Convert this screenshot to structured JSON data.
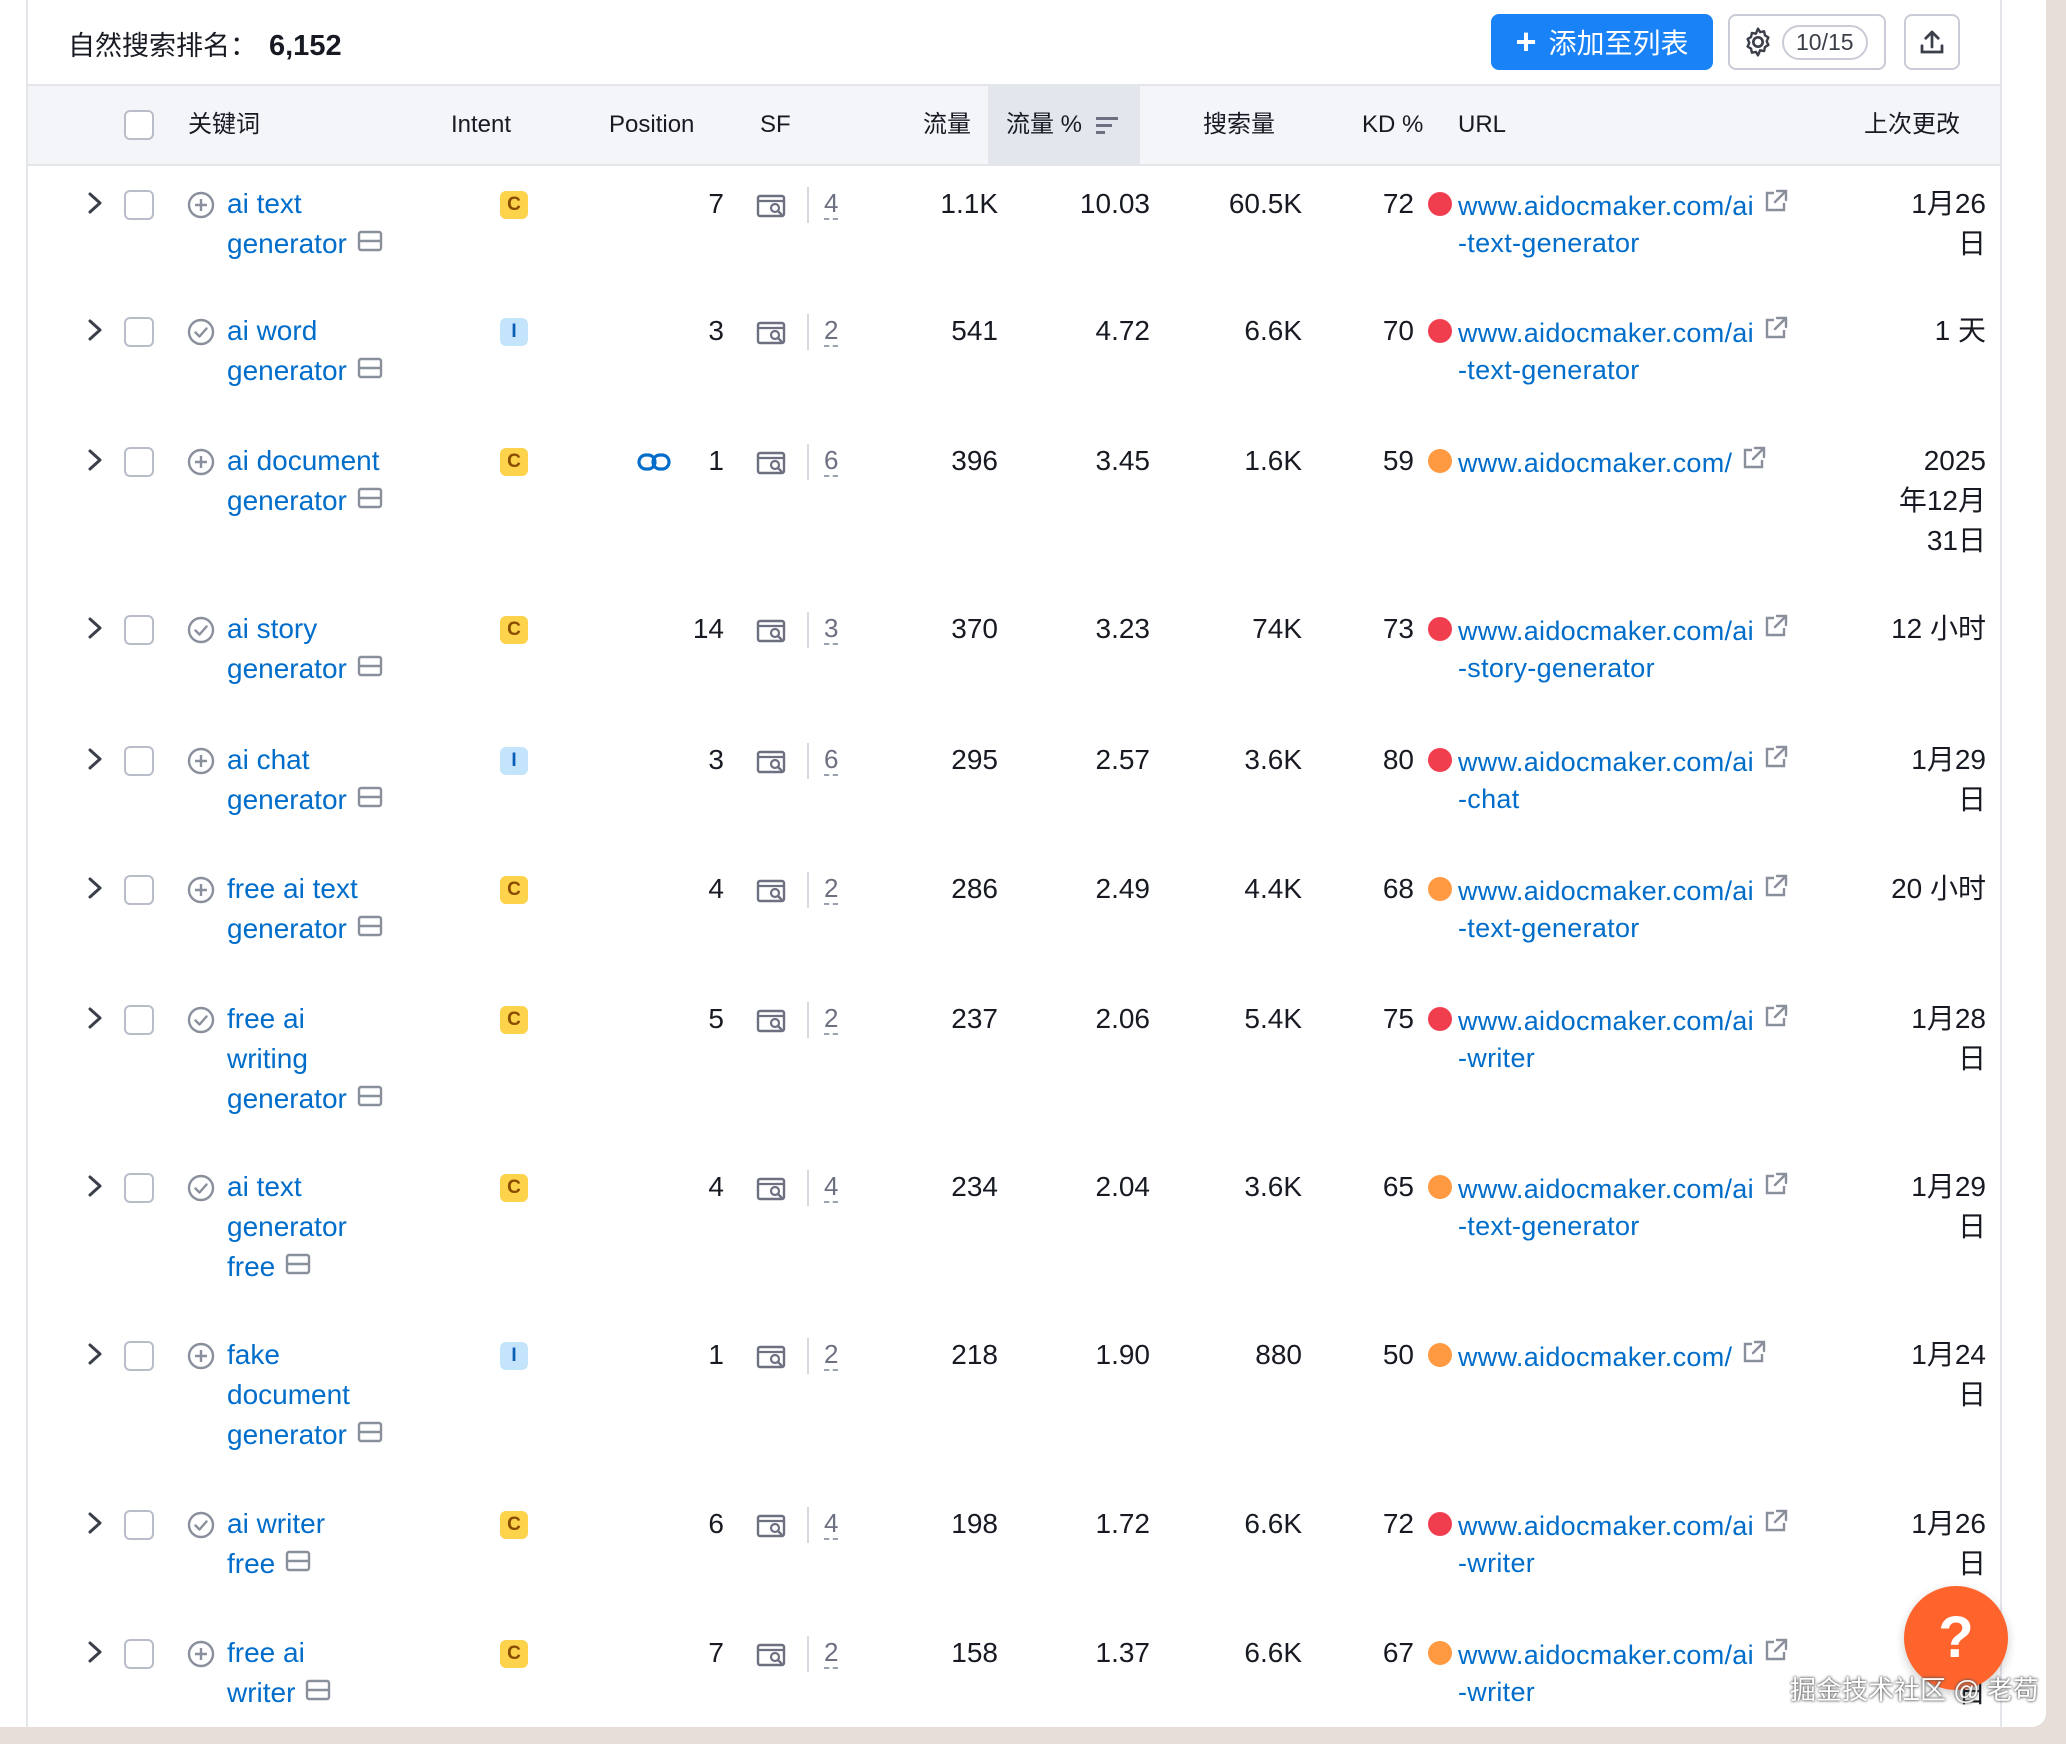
{
  "header": {
    "title": "自然搜索排名：",
    "count": "6,152",
    "add_button": "添加至列表",
    "settings_badge": "10/15"
  },
  "columns": [
    "关键词",
    "Intent",
    "Position",
    "SF",
    "流量",
    "流量 %",
    "搜索量",
    "KD %",
    "URL",
    "上次更改"
  ],
  "rows": [
    {
      "kw": [
        "ai text",
        "generator"
      ],
      "kw_icon": "plus-circle-icon",
      "intent": "C",
      "position": "7",
      "has_link": false,
      "sf": "4",
      "traffic": "1.1K",
      "traffic_pct": "10.03",
      "volume": "60.5K",
      "kd": "72",
      "kd_color": "#f03e4e",
      "url": [
        "www.aidocmaker.com/ai",
        "-text-generator"
      ],
      "updated": [
        "1月26",
        "日"
      ]
    },
    {
      "kw": [
        "ai word",
        "generator"
      ],
      "kw_icon": "check-circle-icon",
      "intent": "I",
      "position": "3",
      "has_link": false,
      "sf": "2",
      "traffic": "541",
      "traffic_pct": "4.72",
      "volume": "6.6K",
      "kd": "70",
      "kd_color": "#f03e4e",
      "url": [
        "www.aidocmaker.com/ai",
        "-text-generator"
      ],
      "updated": [
        "1 天"
      ]
    },
    {
      "kw": [
        "ai document",
        "generator"
      ],
      "kw_icon": "plus-circle-icon",
      "intent": "C",
      "position": "1",
      "has_link": true,
      "sf": "6",
      "traffic": "396",
      "traffic_pct": "3.45",
      "volume": "1.6K",
      "kd": "59",
      "kd_color": "#ff9942",
      "url": [
        "www.aidocmaker.com/"
      ],
      "updated": [
        "2025",
        "年12月",
        "31日"
      ]
    },
    {
      "kw": [
        "ai story",
        "generator"
      ],
      "kw_icon": "check-circle-icon",
      "intent": "C",
      "position": "14",
      "has_link": false,
      "sf": "3",
      "traffic": "370",
      "traffic_pct": "3.23",
      "volume": "74K",
      "kd": "73",
      "kd_color": "#f03e4e",
      "url": [
        "www.aidocmaker.com/ai",
        "-story-generator"
      ],
      "updated": [
        "12 小时"
      ]
    },
    {
      "kw": [
        "ai chat",
        "generator"
      ],
      "kw_icon": "plus-circle-icon",
      "intent": "I",
      "position": "3",
      "has_link": false,
      "sf": "6",
      "traffic": "295",
      "traffic_pct": "2.57",
      "volume": "3.6K",
      "kd": "80",
      "kd_color": "#f03e4e",
      "url": [
        "www.aidocmaker.com/ai",
        "-chat"
      ],
      "updated": [
        "1月29",
        "日"
      ]
    },
    {
      "kw": [
        "free ai text",
        "generator"
      ],
      "kw_icon": "plus-circle-icon",
      "intent": "C",
      "position": "4",
      "has_link": false,
      "sf": "2",
      "traffic": "286",
      "traffic_pct": "2.49",
      "volume": "4.4K",
      "kd": "68",
      "kd_color": "#ff9942",
      "url": [
        "www.aidocmaker.com/ai",
        "-text-generator"
      ],
      "updated": [
        "20 小时"
      ]
    },
    {
      "kw": [
        "free ai",
        "writing",
        "generator"
      ],
      "kw_icon": "check-circle-icon",
      "intent": "C",
      "position": "5",
      "has_link": false,
      "sf": "2",
      "traffic": "237",
      "traffic_pct": "2.06",
      "volume": "5.4K",
      "kd": "75",
      "kd_color": "#f03e4e",
      "url": [
        "www.aidocmaker.com/ai",
        "-writer"
      ],
      "updated": [
        "1月28",
        "日"
      ]
    },
    {
      "kw": [
        "ai text",
        "generator",
        "free"
      ],
      "kw_icon": "check-circle-icon",
      "intent": "C",
      "position": "4",
      "has_link": false,
      "sf": "4",
      "traffic": "234",
      "traffic_pct": "2.04",
      "volume": "3.6K",
      "kd": "65",
      "kd_color": "#ff9942",
      "url": [
        "www.aidocmaker.com/ai",
        "-text-generator"
      ],
      "updated": [
        "1月29",
        "日"
      ]
    },
    {
      "kw": [
        "fake",
        "document",
        "generator"
      ],
      "kw_icon": "plus-circle-icon",
      "intent": "I",
      "position": "1",
      "has_link": false,
      "sf": "2",
      "traffic": "218",
      "traffic_pct": "1.90",
      "volume": "880",
      "kd": "50",
      "kd_color": "#ff9942",
      "url": [
        "www.aidocmaker.com/"
      ],
      "updated": [
        "1月24",
        "日"
      ]
    },
    {
      "kw": [
        "ai writer",
        "free"
      ],
      "kw_icon": "check-circle-icon",
      "intent": "C",
      "position": "6",
      "has_link": false,
      "sf": "4",
      "traffic": "198",
      "traffic_pct": "1.72",
      "volume": "6.6K",
      "kd": "72",
      "kd_color": "#f03e4e",
      "url": [
        "www.aidocmaker.com/ai",
        "-writer"
      ],
      "updated": [
        "1月26",
        "日"
      ]
    },
    {
      "kw": [
        "free ai",
        "writer"
      ],
      "kw_icon": "plus-circle-icon",
      "intent": "C",
      "position": "7",
      "has_link": false,
      "sf": "2",
      "traffic": "158",
      "traffic_pct": "1.37",
      "volume": "6.6K",
      "kd": "67",
      "kd_color": "#ff9942",
      "url": [
        "www.aidocmaker.com/ai",
        "-writer"
      ],
      "updated": [
        "1月",
        "日"
      ]
    }
  ],
  "help_label": "?",
  "watermark": "掘金技术社区 @ 老苟"
}
